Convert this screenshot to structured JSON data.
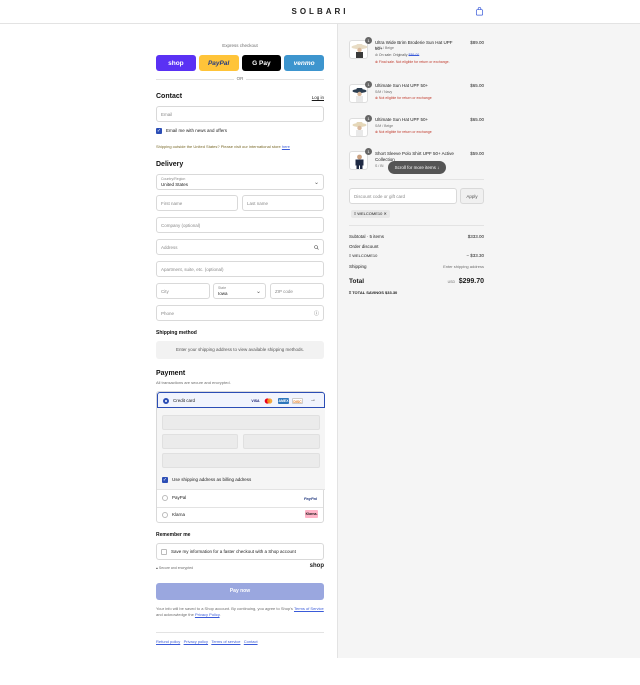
{
  "brand": "SOLBARI",
  "express": {
    "label": "Express checkout",
    "buttons": [
      "shop",
      "PayPal",
      "G Pay",
      "venmo"
    ],
    "or": "OR"
  },
  "contact": {
    "heading": "Contact",
    "login": "Log in",
    "email_placeholder": "Email",
    "news_label": "Email me with news and offers",
    "intl_note": "Shipping outside the United States? Please visit our international store",
    "intl_link": "here"
  },
  "delivery": {
    "heading": "Delivery",
    "country_label": "Country/Region",
    "country_value": "United States",
    "first_name": "First name",
    "last_name": "Last name",
    "company": "Company (optional)",
    "address": "Address",
    "apartment": "Apartment, suite, etc. (optional)",
    "city": "City",
    "state_label": "State",
    "state_value": "Iowa",
    "zip": "ZIP code",
    "phone": "Phone"
  },
  "shipping_method": {
    "heading": "Shipping method",
    "note": "Enter your shipping address to view available shipping methods."
  },
  "payment": {
    "heading": "Payment",
    "subtitle": "All transactions are secure and encrypted.",
    "credit_card": "Credit card",
    "card_brands": [
      "VISA",
      "MC",
      "AMEX",
      "DISC"
    ],
    "billing_same": "Use shipping address as billing address",
    "paypal": "PayPal",
    "paypal_logo": "PayPal",
    "klarna": "Klarna",
    "klarna_logo": "Klarna."
  },
  "remember": {
    "heading": "Remember me",
    "save_label": "Save my information for a faster checkout with a Shop account",
    "secure": "Secure and encrypted",
    "shop_logo": "shop"
  },
  "pay_button": "Pay now",
  "legal": {
    "text1": "Your info will be saved to a Shop account. By continuing, you agree to Shop's",
    "terms": "Terms of Service",
    "text2": "and acknowledge the",
    "privacy": "Privacy Policy"
  },
  "footer_links": [
    "Refund policy",
    "Privacy policy",
    "Terms of service",
    "Contact"
  ],
  "order": {
    "items": [
      {
        "qty": "1",
        "name": "Ultra Wide Brim Broderie Sun Hat UPF 50+",
        "variant": "L/XL / Beige",
        "price": "$89.00",
        "sale": "On sale: Originally",
        "sale_price": "$89.00",
        "final": "Final sale. Not eligible for return or exchange."
      },
      {
        "qty": "1",
        "name": "Ultimate Sun Hat UPF 50+",
        "variant": "S/M / Navy",
        "price": "$65.00",
        "final": "Not eligible for return or exchange"
      },
      {
        "qty": "1",
        "name": "Ultimate Sun Hat UPF 50+",
        "variant": "S/M / Beige",
        "price": "$65.00",
        "final": "Not eligible for return or exchange"
      },
      {
        "qty": "1",
        "name": "Short Sleeve Polo Shirt UPF 50+ Active Collection",
        "variant": "S / Bl",
        "price": "$59.00"
      }
    ],
    "scroll_pill": "Scroll for more items",
    "discount_placeholder": "Discount code or gift card",
    "apply": "Apply",
    "code_chip": "WELCOME10",
    "subtotal_label": "Subtotal · 5 items",
    "subtotal": "$333.00",
    "order_discount": "Order discount",
    "discount_code": "WELCOME10",
    "discount_amount": "− $33.30",
    "shipping_label": "Shipping",
    "shipping_value": "Enter shipping address",
    "total_label": "Total",
    "currency": "USD",
    "total": "$299.70",
    "savings_label": "TOTAL SAVINGS",
    "savings": "$33.30"
  }
}
